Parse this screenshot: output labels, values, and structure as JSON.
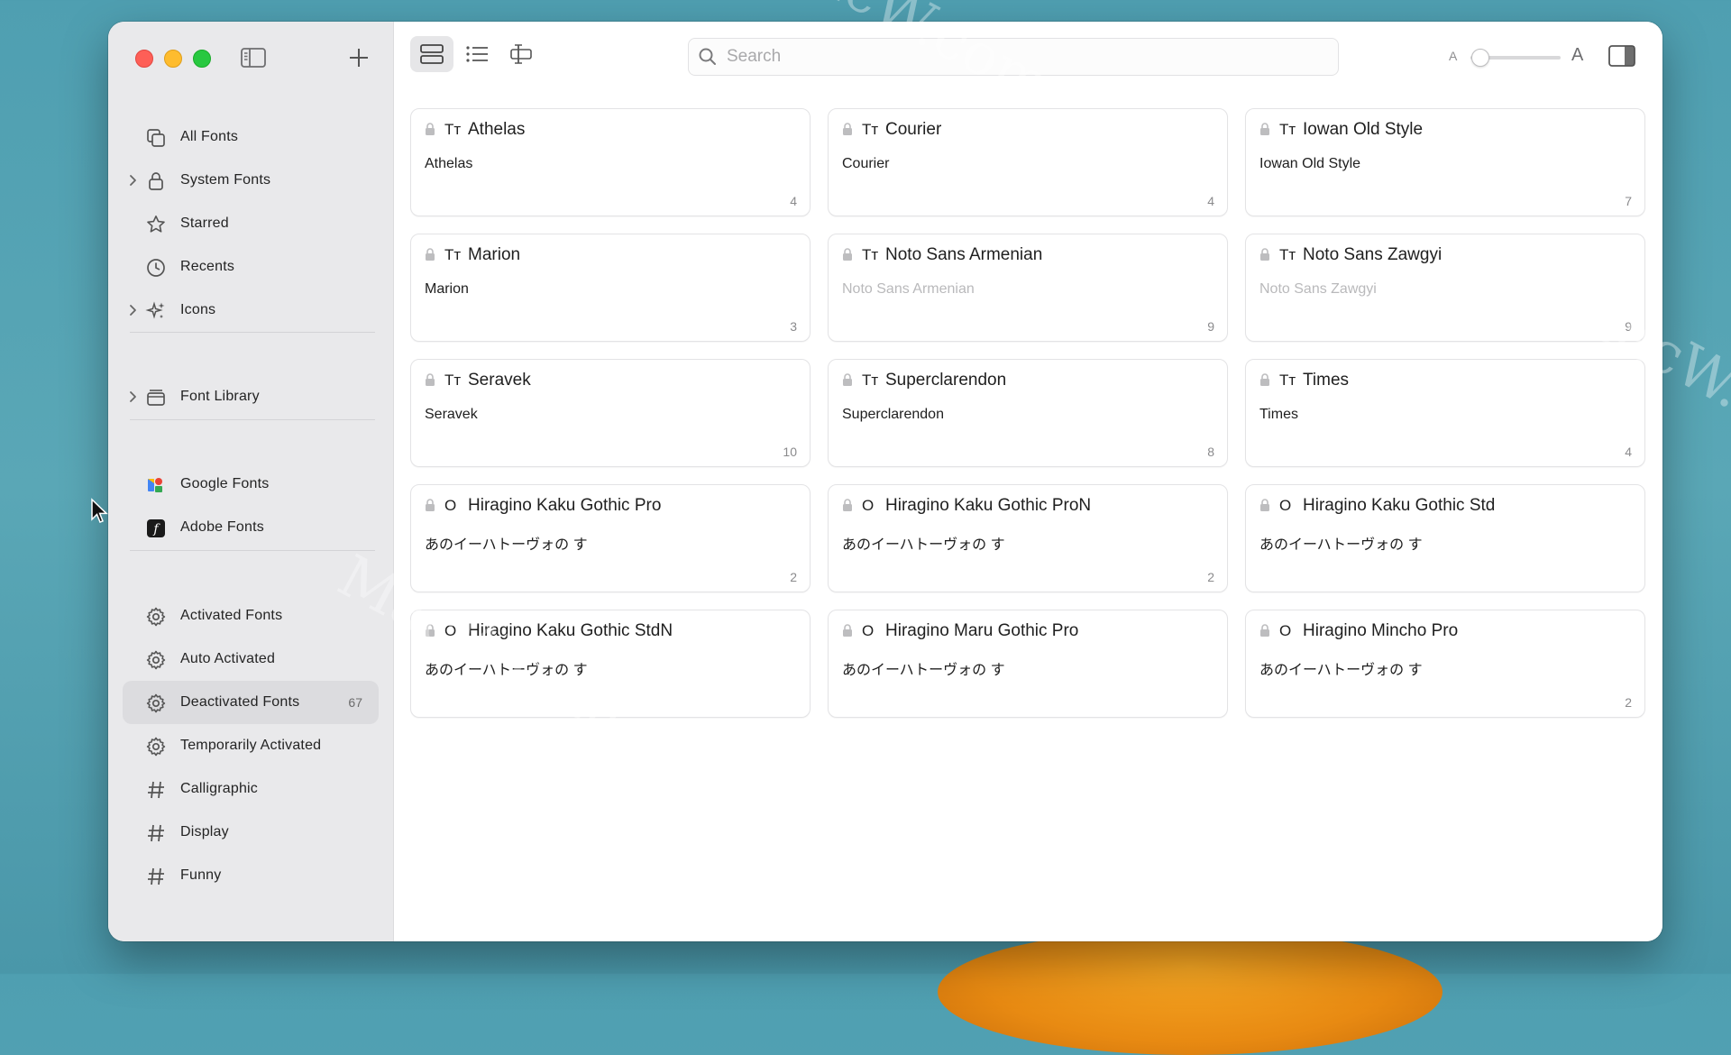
{
  "sidebar": {
    "items": [
      {
        "label": "All Fonts",
        "icon": "all-fonts-icon",
        "chevron": false,
        "count": ""
      },
      {
        "label": "System Fonts",
        "icon": "lock-icon",
        "chevron": true,
        "count": ""
      },
      {
        "label": "Starred",
        "icon": "star-icon",
        "chevron": false,
        "count": ""
      },
      {
        "label": "Recents",
        "icon": "clock-icon",
        "chevron": false,
        "count": ""
      },
      {
        "label": "Icons",
        "icon": "sparkles-icon",
        "chevron": true,
        "count": ""
      }
    ],
    "library": [
      {
        "label": "Font Library",
        "icon": "tray-icon",
        "chevron": true,
        "count": ""
      }
    ],
    "services": [
      {
        "label": "Google Fonts",
        "icon": "google-fonts-icon",
        "count": ""
      },
      {
        "label": "Adobe Fonts",
        "icon": "adobe-fonts-icon",
        "count": ""
      }
    ],
    "smart": [
      {
        "label": "Activated Fonts",
        "icon": "gear-icon",
        "count": ""
      },
      {
        "label": "Auto Activated",
        "icon": "gear-icon",
        "count": ""
      },
      {
        "label": "Deactivated Fonts",
        "icon": "gear-icon",
        "count": "67",
        "selected": true
      },
      {
        "label": "Temporarily Activated",
        "icon": "gear-icon",
        "count": ""
      },
      {
        "label": "Calligraphic",
        "icon": "hash-icon",
        "count": ""
      },
      {
        "label": "Display",
        "icon": "hash-icon",
        "count": ""
      },
      {
        "label": "Funny",
        "icon": "hash-icon",
        "count": ""
      }
    ]
  },
  "toolbar": {
    "search_placeholder": "Search",
    "size_small_label": "A",
    "size_large_label": "A",
    "size_slider_value": 0.1
  },
  "fonts": [
    {
      "name": "Athelas",
      "type": "Tт",
      "sample": "Athelas",
      "count": "4",
      "dim": false
    },
    {
      "name": "Courier",
      "type": "Tт",
      "sample": "Courier",
      "count": "4",
      "dim": false
    },
    {
      "name": "Iowan Old Style",
      "type": "Tт",
      "sample": "Iowan Old Style",
      "count": "7",
      "dim": false
    },
    {
      "name": "Marion",
      "type": "Tт",
      "sample": "Marion",
      "count": "3",
      "dim": false
    },
    {
      "name": "Noto Sans Armenian",
      "type": "Tт",
      "sample": "Noto Sans Armenian",
      "count": "9",
      "dim": true
    },
    {
      "name": "Noto Sans Zawgyi",
      "type": "Tт",
      "sample": "Noto Sans Zawgyi",
      "count": "9",
      "dim": true
    },
    {
      "name": "Seravek",
      "type": "Tт",
      "sample": "Seravek",
      "count": "10",
      "dim": false
    },
    {
      "name": "Superclarendon",
      "type": "Tт",
      "sample": "Superclarendon",
      "count": "8",
      "dim": false
    },
    {
      "name": "Times",
      "type": "Tт",
      "sample": "Times",
      "count": "4",
      "dim": false
    },
    {
      "name": "Hiragino Kaku Gothic Pro",
      "type": "O",
      "sample": "あのイーハトーヴォの す",
      "count": "2",
      "dim": false
    },
    {
      "name": "Hiragino Kaku Gothic ProN",
      "type": "O",
      "sample": "あのイーハトーヴォの す",
      "count": "2",
      "dim": false
    },
    {
      "name": "Hiragino Kaku Gothic Std",
      "type": "O",
      "sample": "あのイーハトーヴォの す",
      "count": "",
      "dim": false
    },
    {
      "name": "Hiragino Kaku Gothic StdN",
      "type": "O",
      "sample": "あのイーハトーヴォの す",
      "count": "",
      "dim": false
    },
    {
      "name": "Hiragino Maru Gothic Pro",
      "type": "O",
      "sample": "あのイーハトーヴォの す",
      "count": "",
      "dim": false
    },
    {
      "name": "Hiragino Mincho Pro",
      "type": "O",
      "sample": "あのイーハトーヴォの す",
      "count": "2",
      "dim": false
    }
  ],
  "watermarks": [
    "MacW.com",
    "MacW.com",
    "MacW.com"
  ],
  "colors": {
    "selected_bg": "#dcdcdf",
    "close": "#fe5f57",
    "minimize": "#febc2e",
    "zoom": "#28c840"
  }
}
